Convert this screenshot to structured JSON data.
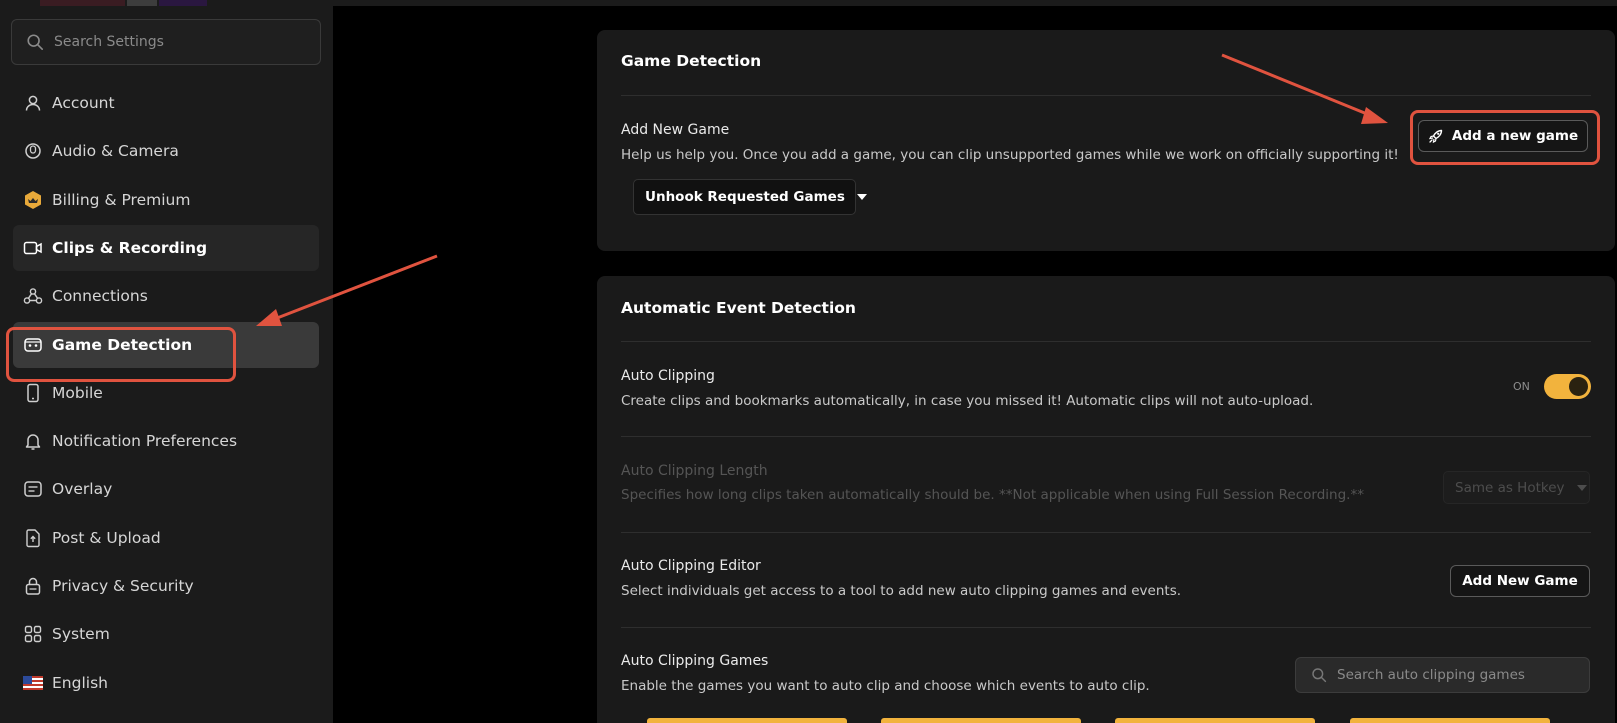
{
  "sidebar": {
    "search_placeholder": "Search Settings",
    "items": [
      {
        "label": "Account",
        "icon": "user-icon"
      },
      {
        "label": "Audio & Camera",
        "icon": "microphone-icon"
      },
      {
        "label": "Billing & Premium",
        "icon": "premium-badge-icon"
      },
      {
        "label": "Clips & Recording",
        "icon": "video-camera-icon"
      },
      {
        "label": "Connections",
        "icon": "connections-icon"
      },
      {
        "label": "Game Detection",
        "icon": "gamepad-icon"
      },
      {
        "label": "Mobile",
        "icon": "mobile-icon"
      },
      {
        "label": "Notification Preferences",
        "icon": "bell-icon"
      },
      {
        "label": "Overlay",
        "icon": "overlay-icon"
      },
      {
        "label": "Post & Upload",
        "icon": "upload-icon"
      },
      {
        "label": "Privacy & Security",
        "icon": "lock-icon"
      },
      {
        "label": "System",
        "icon": "grid-icon"
      },
      {
        "label": "English",
        "icon": "us-flag-icon"
      }
    ]
  },
  "game_detection": {
    "title": "Game Detection",
    "add_new_game": {
      "title": "Add New Game",
      "description": "Help us help you. Once you add a game, you can clip unsupported games while we work on officially supporting it!",
      "button_label": "Add a new game",
      "button_icon": "rocket-icon"
    },
    "unhook_dropdown_label": "Unhook Requested Games"
  },
  "auto_event_detection": {
    "title": "Automatic Event Detection",
    "auto_clipping": {
      "title": "Auto Clipping",
      "description": "Create clips and bookmarks automatically, in case you missed it! Automatic clips will not auto-upload.",
      "toggle_state_label": "ON",
      "enabled": true
    },
    "auto_clipping_length": {
      "title": "Auto Clipping Length",
      "description": "Specifies how long clips taken automatically should be. **Not applicable when using Full Session Recording.**",
      "selected_value": "Same as Hotkey",
      "disabled": true
    },
    "auto_clipping_editor": {
      "title": "Auto Clipping Editor",
      "description": "Select individuals get access to a tool to add new auto clipping games and events.",
      "button_label": "Add New Game"
    },
    "auto_clipping_games": {
      "title": "Auto Clipping Games",
      "description": "Enable the games you want to auto clip and choose which events to auto clip.",
      "search_placeholder": "Search auto clipping games"
    }
  },
  "colors": {
    "accent": "#f2b33d",
    "highlight": "#e0533f",
    "sidebar_bg": "#1b1b1b",
    "card_bg": "#1a1a1a"
  }
}
